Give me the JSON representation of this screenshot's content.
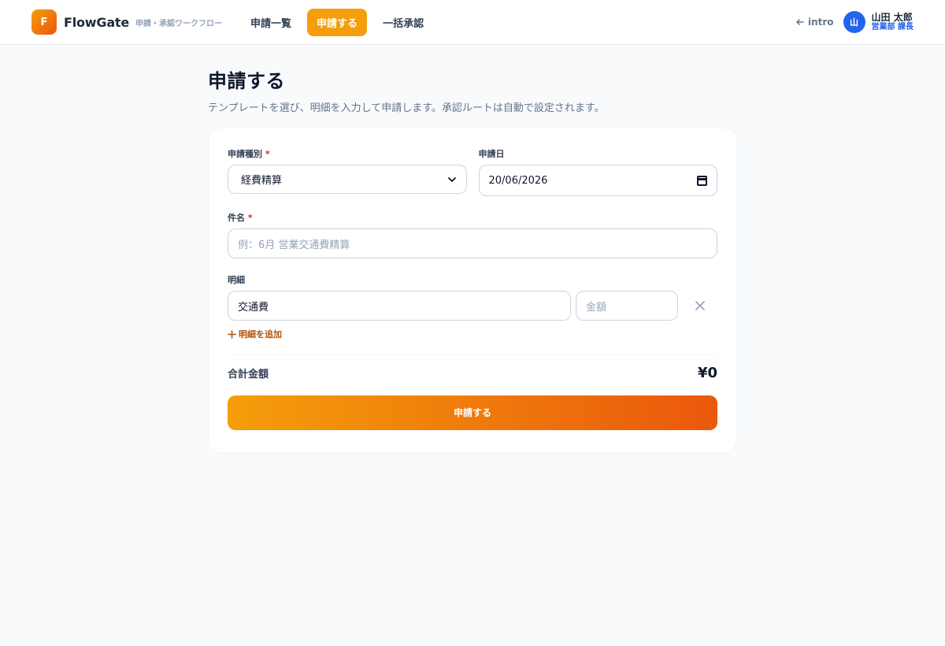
{
  "header": {
    "logo_letter": "F",
    "brand": "FlowGate",
    "brand_sub": "申請・承認ワークフロー",
    "nav": [
      {
        "label": "申請一覧"
      },
      {
        "label": "申請する"
      },
      {
        "label": "一括承認"
      }
    ],
    "intro_label": "intro",
    "user": {
      "avatar_letter": "山",
      "name": "山田 太郎",
      "role": "営業部 課長"
    }
  },
  "page": {
    "title": "申請する",
    "description": "テンプレートを選び、明細を入力して申請します。承認ルートは自動で設定されます。"
  },
  "form": {
    "type_label": "申請種別",
    "type_value": "経費精算",
    "date_label": "申請日",
    "date_value": "20/06/2026",
    "subject_label": "件名",
    "subject_placeholder": "例：6月 営業交通費精算",
    "lines_label": "明細",
    "lines": [
      {
        "item": "交通費",
        "amount_placeholder": "金額"
      }
    ],
    "add_line_label": "明細を追加",
    "required_mark": "*",
    "total_label": "合計金額",
    "total_value": "¥0",
    "submit_label": "申請する"
  },
  "colors": {
    "accent": "#f59e0b",
    "accent_dark": "#ea580c",
    "user_blue": "#2563eb"
  }
}
